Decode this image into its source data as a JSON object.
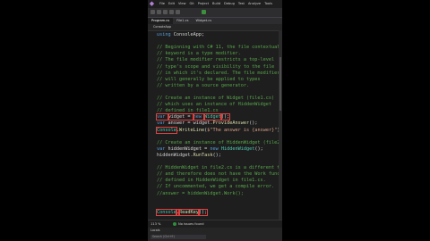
{
  "menu": [
    "File",
    "Edit",
    "View",
    "Git",
    "Project",
    "Build",
    "Debug",
    "Test",
    "Analyze",
    "Tools"
  ],
  "tabs": [
    {
      "label": "Program.cs"
    },
    {
      "label": "File1.cs"
    },
    {
      "label": "Widget.cs"
    }
  ],
  "navbar": {
    "label": "ConsoleApp"
  },
  "code_lines": [
    [
      {
        "t": "using ",
        "c": "key"
      },
      {
        "t": "ConsoleApp;",
        "c": "def"
      }
    ],
    [],
    [
      {
        "t": "// Beginning with C# 11, the file contextual",
        "c": "com"
      }
    ],
    [
      {
        "t": "// keyword is a type modifier.",
        "c": "com"
      }
    ],
    [
      {
        "t": "// The file modifier restricts a top-level",
        "c": "com"
      }
    ],
    [
      {
        "t": "// type's scope and visibility to the file",
        "c": "com"
      }
    ],
    [
      {
        "t": "// in which it's declared. The file modifier",
        "c": "com"
      }
    ],
    [
      {
        "t": "// will generally be applied to types",
        "c": "com"
      }
    ],
    [
      {
        "t": "// written by a source generator.",
        "c": "com"
      }
    ],
    [],
    [
      {
        "t": "// Create an instance of Widget (file1.cs)",
        "c": "com"
      }
    ],
    [
      {
        "t": "// which uses an instance of HiddenWidget",
        "c": "com"
      }
    ],
    [
      {
        "t": "// defined in file1.cs",
        "c": "com"
      }
    ],
    [
      {
        "t": "var ",
        "c": "key",
        "hl": true
      },
      {
        "t": "widget = ",
        "c": "def",
        "hl": true
      },
      {
        "t": "new ",
        "c": "key",
        "hl": true
      },
      {
        "t": "Widget",
        "c": "typ",
        "hl": true
      },
      {
        "t": "();",
        "c": "def",
        "hl": true
      }
    ],
    [
      {
        "t": "var ",
        "c": "key"
      },
      {
        "t": "answer = widget.",
        "c": "def"
      },
      {
        "t": "ProvideAnswer",
        "c": "met"
      },
      {
        "t": "();",
        "c": "def"
      }
    ],
    [
      {
        "t": "Console",
        "c": "typ",
        "hl": true
      },
      {
        "t": ".",
        "c": "def"
      },
      {
        "t": "WriteLine",
        "c": "met"
      },
      {
        "t": "(",
        "c": "def"
      },
      {
        "t": "$\"The answer is {answer}\"",
        "c": "str"
      },
      {
        "t": ");",
        "c": "def"
      }
    ],
    [],
    [
      {
        "t": "// Create an instance of HiddenWidget (file2.",
        "c": "com"
      }
    ],
    [
      {
        "t": "var ",
        "c": "key"
      },
      {
        "t": "hiddenWidget = ",
        "c": "def"
      },
      {
        "t": "new ",
        "c": "key"
      },
      {
        "t": "HiddenWidget",
        "c": "typ"
      },
      {
        "t": "();",
        "c": "def"
      }
    ],
    [
      {
        "t": "hiddenWidget.",
        "c": "def"
      },
      {
        "t": "RunTask",
        "c": "met"
      },
      {
        "t": "();",
        "c": "def"
      }
    ],
    [],
    [
      {
        "t": "// HiddenWidget in file2.cs is a different type",
        "c": "com"
      }
    ],
    [
      {
        "t": "// and therefore does not have the Work funct",
        "c": "com"
      }
    ],
    [
      {
        "t": "// defined in HiddenWidget in file1.cs.",
        "c": "com"
      }
    ],
    [
      {
        "t": "// If uncommented, we get a compile error.",
        "c": "com"
      }
    ],
    [
      {
        "t": "//answer = hiddenWidget.Work();",
        "c": "com"
      }
    ],
    [],
    [],
    [
      {
        "t": "Console",
        "c": "typ",
        "hl": true
      },
      {
        "t": ".",
        "c": "def",
        "hl": true
      },
      {
        "t": "ReadKey",
        "c": "met",
        "hl": true
      },
      {
        "t": "();",
        "c": "def",
        "hl": true
      }
    ]
  ],
  "status": {
    "zoom": "113 %",
    "issues": "No issues found"
  },
  "bottom_panel": {
    "title": "Locals",
    "search": "Search (Ctrl+E)"
  }
}
